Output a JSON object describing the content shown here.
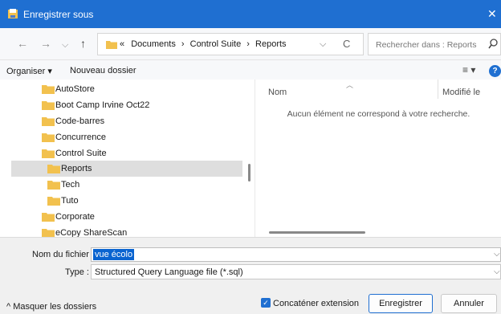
{
  "window": {
    "title": "Enregistrer sous",
    "close_glyph": "✕"
  },
  "nav": {
    "back": "←",
    "forward": "→",
    "recent": "⌵",
    "up": "↑"
  },
  "address": {
    "overflow": "«",
    "crumbs": [
      "Documents",
      "Control Suite",
      "Reports"
    ],
    "separator": "›",
    "dropdown": "⌵",
    "refresh": "C"
  },
  "search": {
    "placeholder": "Rechercher dans : Reports"
  },
  "toolbar": {
    "organize_label": "Organiser ▾",
    "new_folder_label": "Nouveau dossier",
    "view_glyph": "≡ ▾",
    "help_glyph": "?"
  },
  "tree": [
    {
      "label": "AutoStore"
    },
    {
      "label": "Boot Camp Irvine Oct22"
    },
    {
      "label": "Code-barres"
    },
    {
      "label": "Concurrence"
    },
    {
      "label": "Control Suite"
    },
    {
      "label": "Reports"
    },
    {
      "label": "Tech"
    },
    {
      "label": "Tuto"
    },
    {
      "label": "Corporate"
    },
    {
      "label": "eCopy ShareScan"
    }
  ],
  "file_list": {
    "col_name": "Nom",
    "col_modified": "Modifié le",
    "empty_message": "Aucun élément ne correspond à votre recherche."
  },
  "form": {
    "filename_label": "Nom du fichier :",
    "filename_value": "vue écolo",
    "type_label": "Type :",
    "type_value": "Structured Query Language file (*.sql)",
    "dropdown_glyph": "⌵"
  },
  "footer": {
    "hide_folders_label": "^ Masquer les dossiers",
    "concat_label": "Concaténer extension",
    "concat_checked": true,
    "save_label": "Enregistrer",
    "cancel_label": "Annuler"
  },
  "colors": {
    "accent": "#1f6fd1",
    "folder": "#f2c14e",
    "selected_row": "#dedede"
  }
}
